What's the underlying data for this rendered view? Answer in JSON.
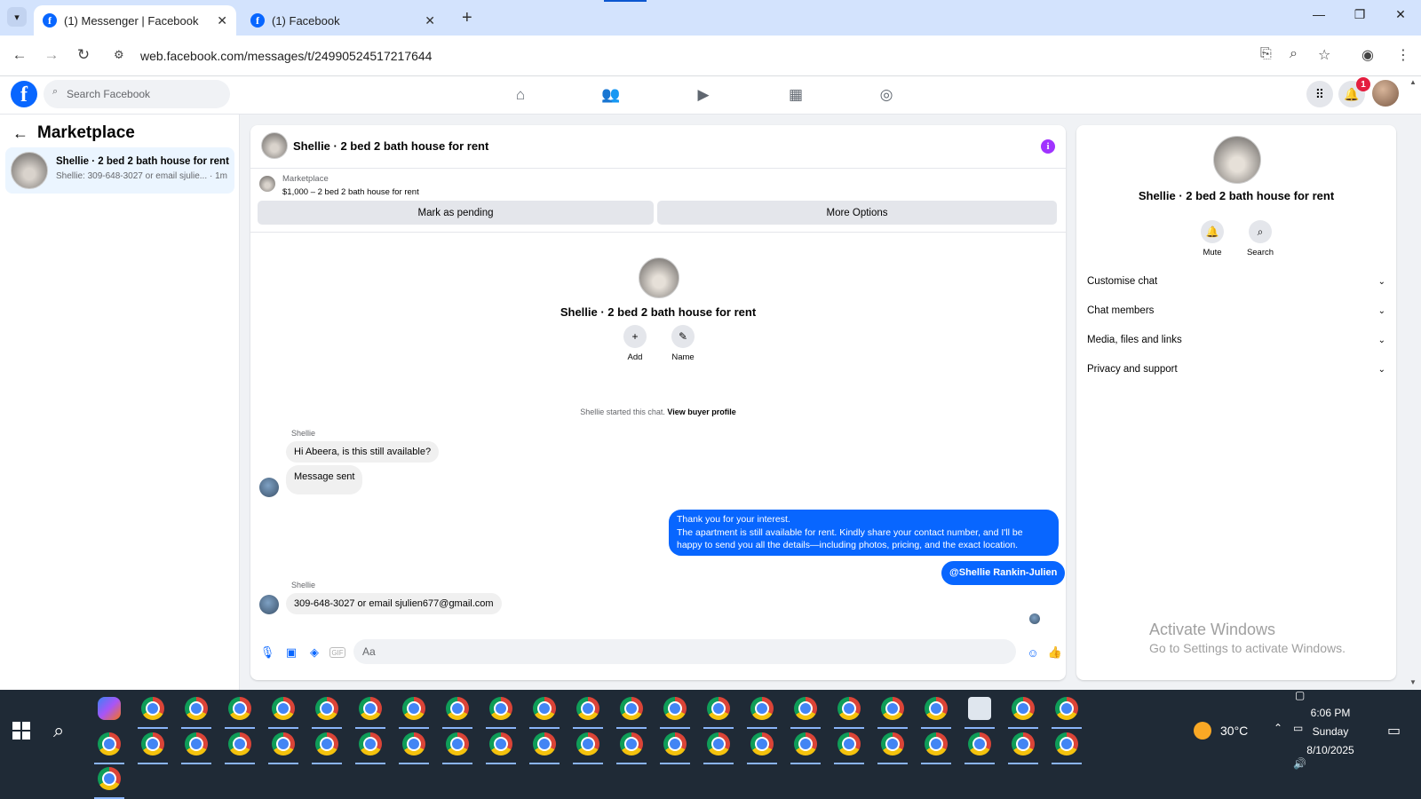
{
  "browser": {
    "tabs": [
      {
        "title": "(1) Messenger | Facebook",
        "active": true
      },
      {
        "title": "(1) Facebook",
        "active": false
      }
    ],
    "url": "web.facebook.com/messages/t/24990524517217644"
  },
  "fb_header": {
    "search_placeholder": "Search Facebook",
    "notification_count": "1",
    "nav_icons": [
      "home-icon",
      "friends-icon",
      "video-icon",
      "marketplace-icon",
      "groups-icon"
    ]
  },
  "sidebar": {
    "title": "Marketplace",
    "conversation": {
      "title": "Shellie · 2 bed 2 bath house for rent",
      "preview": "Shellie: 309-648-3027 or email sjulie...",
      "time": "· 1m"
    }
  },
  "chat": {
    "title": "Shellie · 2 bed 2 bath house for rent",
    "marketplace_label": "Marketplace",
    "listing_price": "$1,000 – 2 bed 2 bath house for rent",
    "mark_pending_label": "Mark as pending",
    "more_options_label": "More Options",
    "intro_title": "Shellie · 2 bed 2 bath house for rent",
    "add_label": "Add",
    "name_label": "Name",
    "started_text": "Shellie started this chat.",
    "view_buyer_profile": "View buyer profile",
    "messages": [
      {
        "sender": "Shellie",
        "text": "Hi Abeera, is this still available?"
      },
      {
        "sender": "",
        "text": "Message sent"
      },
      {
        "sender": "me",
        "lines": [
          "Thank you for your interest.",
          "The apartment is still available for rent. Kindly share your contact number, and I'll be",
          "happy to send you all the details—including photos, pricing, and the exact location."
        ]
      },
      {
        "sender": "me",
        "text": "@Shellie Rankin-Julien"
      },
      {
        "sender": "Shellie",
        "text": "309-648-3027  or email sjulien677@gmail.com"
      }
    ],
    "composer_placeholder": "Aa"
  },
  "right_panel": {
    "title": "Shellie · 2 bed 2 bath house for rent",
    "mute_label": "Mute",
    "search_label": "Search",
    "sections": [
      "Customise chat",
      "Chat members",
      "Media, files and links",
      "Privacy and support"
    ]
  },
  "watermark": {
    "line1": "Activate Windows",
    "line2": "Go to Settings to activate Windows."
  },
  "taskbar": {
    "weather": "30°C",
    "time": "6:06 PM",
    "day": "Sunday",
    "date": "8/10/2025"
  }
}
